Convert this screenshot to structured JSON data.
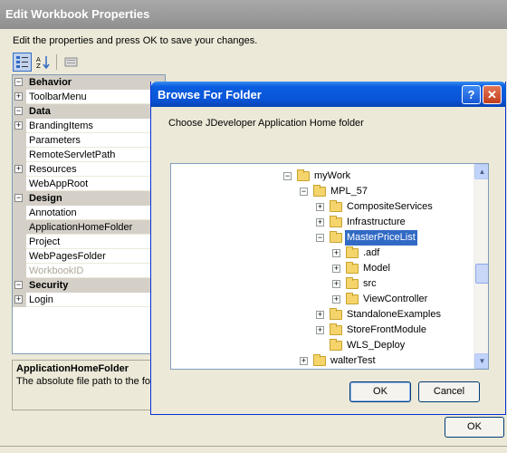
{
  "window": {
    "title": "Edit Workbook Properties"
  },
  "instructions": "Edit the properties and press OK to save your changes.",
  "toolbar": {
    "categorized_icon": "categorized-icon",
    "alphabetical_icon": "sort-az-icon",
    "pages_icon": "property-pages-icon"
  },
  "property_grid": {
    "rows": [
      {
        "kind": "cat",
        "label": "Behavior",
        "exp": "⊟"
      },
      {
        "kind": "item",
        "label": "ToolbarMenu",
        "exp": "+"
      },
      {
        "kind": "cat",
        "label": "Data",
        "exp": "⊟"
      },
      {
        "kind": "item",
        "label": "BrandingItems",
        "exp": "+"
      },
      {
        "kind": "item",
        "label": "Parameters"
      },
      {
        "kind": "item",
        "label": "RemoteServletPath"
      },
      {
        "kind": "item",
        "label": "Resources",
        "exp": "+"
      },
      {
        "kind": "item",
        "label": "WebAppRoot"
      },
      {
        "kind": "cat",
        "label": "Design",
        "exp": "⊟"
      },
      {
        "kind": "item",
        "label": "Annotation"
      },
      {
        "kind": "item",
        "label": "ApplicationHomeFolder",
        "selected": true
      },
      {
        "kind": "item",
        "label": "Project"
      },
      {
        "kind": "item",
        "label": "WebPagesFolder"
      },
      {
        "kind": "item",
        "label": "WorkbookID",
        "disabled": true
      },
      {
        "kind": "cat",
        "label": "Security",
        "exp": "⊟"
      },
      {
        "kind": "item",
        "label": "Login",
        "exp": "+"
      }
    ]
  },
  "description": {
    "title": "ApplicationHomeFolder",
    "text": "The absolute file path to the fol"
  },
  "outer_ok_label": "OK",
  "browse": {
    "title": "Browse For Folder",
    "help_label": "?",
    "close_label": "✕",
    "prompt": "Choose JDeveloper Application Home folder",
    "tree": [
      {
        "label": "myWork",
        "level": 0,
        "exp": "−"
      },
      {
        "label": "MPL_57",
        "level": 1,
        "exp": "−"
      },
      {
        "label": "CompositeServices",
        "level": 2,
        "exp": "+"
      },
      {
        "label": "Infrastructure",
        "level": 2,
        "exp": "+"
      },
      {
        "label": "MasterPriceList",
        "level": 2,
        "exp": "−",
        "selected": true
      },
      {
        "label": ".adf",
        "level": 3,
        "exp": "+"
      },
      {
        "label": "Model",
        "level": 3,
        "exp": "+"
      },
      {
        "label": "src",
        "level": 3,
        "exp": "+"
      },
      {
        "label": "ViewController",
        "level": 3,
        "exp": "+"
      },
      {
        "label": "StandaloneExamples",
        "level": 2,
        "exp": "+"
      },
      {
        "label": "StoreFrontModule",
        "level": 2,
        "exp": "+"
      },
      {
        "label": "WLS_Deploy",
        "level": 2
      },
      {
        "label": "walterTest",
        "level": 1,
        "exp": "+"
      }
    ],
    "ok_label": "OK",
    "cancel_label": "Cancel"
  }
}
